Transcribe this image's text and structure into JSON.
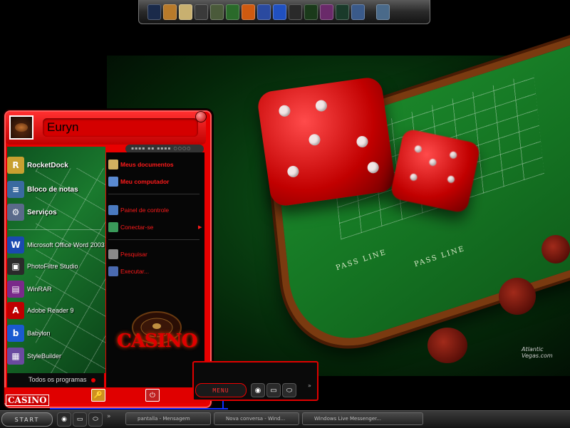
{
  "dock": {
    "icons": [
      {
        "name": "rocketdock-icon",
        "color": "#1a2a4a"
      },
      {
        "name": "home-icon",
        "color": "#b87a2a"
      },
      {
        "name": "notes-icon",
        "color": "#c8b070"
      },
      {
        "name": "pencil-icon",
        "color": "#3a3a3a"
      },
      {
        "name": "book-icon",
        "color": "#4a5a3a"
      },
      {
        "name": "globe-icon",
        "color": "#2a6a2a"
      },
      {
        "name": "firefox-icon",
        "color": "#d05a10"
      },
      {
        "name": "shield-icon",
        "color": "#2a4aa0"
      },
      {
        "name": "gauge-icon",
        "color": "#2050c0"
      },
      {
        "name": "media-player-icon",
        "color": "#2a2a2a"
      },
      {
        "name": "photofiltre-icon",
        "color": "#1a3a1a"
      },
      {
        "name": "winrar-icon",
        "color": "#6a2a6a"
      },
      {
        "name": "monitor-icon",
        "color": "#1a3a2a"
      },
      {
        "name": "computer-icon",
        "color": "#3a5a8a"
      },
      {
        "name": "recycle-bin-icon",
        "color": "#4a6a8a"
      }
    ]
  },
  "start_menu": {
    "username": "Euryn",
    "left_pinned": [
      {
        "label": "RocketDock",
        "icon": "rocketdock-icon",
        "color": "#c8a030",
        "glyph": "R"
      },
      {
        "label": "Bloco de notas",
        "icon": "notepad-icon",
        "color": "#3a6aa0",
        "glyph": "≡"
      },
      {
        "label": "Serviços",
        "icon": "gears-icon",
        "color": "#5a6a8a",
        "glyph": "⚙"
      }
    ],
    "left_recent": [
      {
        "label": "Microsoft Office Word 2003",
        "icon": "word-icon",
        "color": "#1a4ab0",
        "glyph": "W"
      },
      {
        "label": "PhotoFiltre Studio",
        "icon": "photofiltre-icon",
        "color": "#2a2a2a",
        "glyph": "▣"
      },
      {
        "label": "WinRAR",
        "icon": "winrar-icon",
        "color": "#7a2a8a",
        "glyph": "▤"
      },
      {
        "label": "Adobe Reader 9",
        "icon": "adobe-reader-icon",
        "color": "#c00000",
        "glyph": "A"
      },
      {
        "label": "Babylon",
        "icon": "babylon-icon",
        "color": "#1a5ad0",
        "glyph": "b"
      },
      {
        "label": "StyleBuilder",
        "icon": "stylebuilder-icon",
        "color": "#6a4aa0",
        "glyph": "▦"
      }
    ],
    "all_programs": "Todos os programas",
    "right_items": [
      {
        "label": "Meus documentos",
        "icon": "folder-icon",
        "color": "#d0b060",
        "bold": true
      },
      {
        "label": "Meu computador",
        "icon": "computer-icon",
        "color": "#5a8ad0",
        "bold": true
      },
      {
        "label": "Painel de controle",
        "icon": "control-panel-icon",
        "color": "#4a7ac0",
        "bold": false
      },
      {
        "label": "Conectar-se",
        "icon": "network-icon",
        "color": "#3a9a5a",
        "bold": false
      },
      {
        "label": "Pesquisar",
        "icon": "search-icon",
        "color": "#8a8a8a",
        "bold": false
      },
      {
        "label": "Executar...",
        "icon": "run-icon",
        "color": "#4a6ab0",
        "bold": false
      }
    ],
    "casino_logo": "CASINO",
    "footer_logo": "CASINO"
  },
  "clock": {
    "time": "MENU"
  },
  "taskbar": {
    "start_label": "START",
    "tasks": [
      "pantalla - Mensagem",
      "Nova conversa - Wind...",
      "Windows Live Messenger..."
    ]
  },
  "wallpaper": {
    "brand": "Atlantic Vegas.com"
  }
}
